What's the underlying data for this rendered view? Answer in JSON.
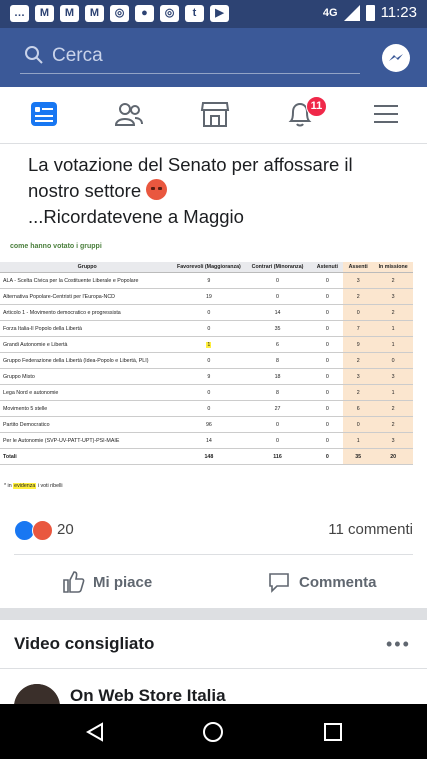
{
  "status_bar": {
    "network": "4G",
    "time": "11:23",
    "notification_icons": [
      "chat-icon",
      "gmail-icon",
      "gmail-icon",
      "gmail-icon",
      "instagram-icon",
      "app-icon",
      "instagram-icon",
      "tumblr-icon",
      "youtube-icon"
    ]
  },
  "search": {
    "placeholder": "Cerca"
  },
  "nav": {
    "notifications_badge": "11"
  },
  "post": {
    "text_line1": "La votazione del Senato per affossare il",
    "text_line2": "nostro settore",
    "text_line3": "...Ricordatevene a Maggio",
    "image": {
      "caption": "come hanno votato i gruppi",
      "columns": [
        "Gruppo",
        "Favorevoli (Maggioranza)",
        "Contrari (Minoranza)",
        "Astenuti",
        "Assenti",
        "In missione"
      ],
      "rows": [
        {
          "group": "ALA - Scelta Civica per la Costituente Liberale e Popolare",
          "fav": "9",
          "con": "0",
          "ast": "0",
          "ass": "3",
          "mis": "2"
        },
        {
          "group": "Alternativa Popolare-Centristi per l'Europa-NCD",
          "fav": "19",
          "con": "0",
          "ast": "0",
          "ass": "2",
          "mis": "3"
        },
        {
          "group": "Articolo 1 - Movimento democratico e progressista",
          "fav": "0",
          "con": "14",
          "ast": "0",
          "ass": "0",
          "mis": "2"
        },
        {
          "group": "Forza Italia-Il Popolo della Libertà",
          "fav": "0",
          "con": "35",
          "ast": "0",
          "ass": "7",
          "mis": "1"
        },
        {
          "group": "Grandi Autonomie e Libertà",
          "fav": "1",
          "con": "6",
          "ast": "0",
          "ass": "9",
          "mis": "1"
        },
        {
          "group": "Gruppo Federazione della Libertà (Idea-Popolo e Libertà, PLI)",
          "fav": "0",
          "con": "8",
          "ast": "0",
          "ass": "2",
          "mis": "0"
        },
        {
          "group": "Gruppo Misto",
          "fav": "9",
          "con": "18",
          "ast": "0",
          "ass": "3",
          "mis": "3"
        },
        {
          "group": "Lega Nord e autonomie",
          "fav": "0",
          "con": "8",
          "ast": "0",
          "ass": "2",
          "mis": "1"
        },
        {
          "group": "Movimento 5 stelle",
          "fav": "0",
          "con": "27",
          "ast": "0",
          "ass": "6",
          "mis": "2"
        },
        {
          "group": "Partito Democratico",
          "fav": "96",
          "con": "0",
          "ast": "0",
          "ass": "0",
          "mis": "2"
        },
        {
          "group": "Per le Autonomie (SVP-UV-PATT-UPT)-PSI-MAIE",
          "fav": "14",
          "con": "0",
          "ast": "0",
          "ass": "1",
          "mis": "3"
        }
      ],
      "totals": {
        "group": "Totali",
        "fav": "148",
        "con": "116",
        "ast": "0",
        "ass": "35",
        "mis": "20"
      },
      "footnote_pre": "* in ",
      "footnote_highlight": "evidenza",
      "footnote_post": " i voti ribelli"
    },
    "reactions_count": "20",
    "comments_count": "11 commenti",
    "like_label": "Mi piace",
    "comment_label": "Commenta"
  },
  "recommended": {
    "title": "Video consigliato",
    "page_name": "On Web Store Italia"
  },
  "colors": {
    "brand": "#3b5998",
    "statusbar": "#2d4373",
    "badge": "#f02849",
    "like": "#1877f2"
  }
}
